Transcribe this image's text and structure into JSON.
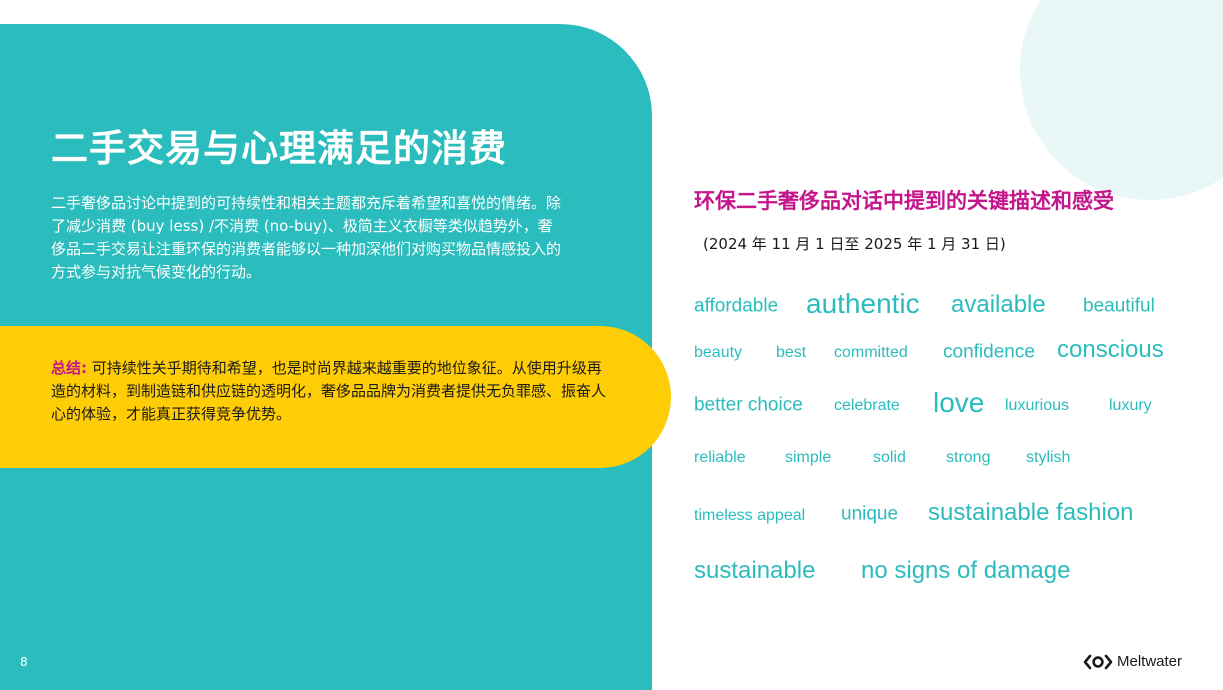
{
  "slide": {
    "title": "二手交易与心理满足的消费",
    "intro": "二手奢侈品讨论中提到的可持续性和相关主题都充斥着希望和喜悦的情绪。除了减少消费 (buy less) /不消费 (no-buy)、极简主义衣橱等类似趋势外，奢侈品二手交易让注重环保的消费者能够以一种加深他们对购买物品情感投入的方式参与对抗气候变化的行动。",
    "summary_label": "总结:",
    "summary_text": " 可持续性关乎期待和希望，也是时尚界越来越重要的地位象征。从使用升级再造的材料，到制造链和供应链的透明化，奢侈品品牌为消费者提供无负罪感、振奋人心的体验，才能真正获得竞争优势。",
    "page_number": "8"
  },
  "word_cloud": {
    "title": "环保二手奢侈品对话中提到的关键描述和感受",
    "date_range": "(2024 年 11 月 1 日至 2025 年 1 月 31 日)",
    "words": [
      {
        "text": "affordable",
        "size": "m"
      },
      {
        "text": "authentic",
        "size": "xl"
      },
      {
        "text": "available",
        "size": "l"
      },
      {
        "text": "beautiful",
        "size": "m"
      },
      {
        "text": "beauty",
        "size": "s"
      },
      {
        "text": "best",
        "size": "s"
      },
      {
        "text": "committed",
        "size": "s"
      },
      {
        "text": "confidence",
        "size": "m"
      },
      {
        "text": "conscious",
        "size": "l"
      },
      {
        "text": "better choice",
        "size": "m"
      },
      {
        "text": "celebrate",
        "size": "s"
      },
      {
        "text": "love",
        "size": "xl"
      },
      {
        "text": "luxurious",
        "size": "s"
      },
      {
        "text": "luxury",
        "size": "s"
      },
      {
        "text": "reliable",
        "size": "s"
      },
      {
        "text": "simple",
        "size": "s"
      },
      {
        "text": "solid",
        "size": "s"
      },
      {
        "text": "strong",
        "size": "s"
      },
      {
        "text": "stylish",
        "size": "s"
      },
      {
        "text": "timeless appeal",
        "size": "s"
      },
      {
        "text": "unique",
        "size": "m"
      },
      {
        "text": "sustainable fashion",
        "size": "l"
      },
      {
        "text": "sustainable",
        "size": "l"
      },
      {
        "text": "no signs of damage",
        "size": "l"
      }
    ]
  },
  "brand": {
    "name": "Meltwater",
    "icon": "meltwater-logo-icon"
  },
  "colors": {
    "teal": "#2bbcbd",
    "yellow": "#ffcd05",
    "magenta": "#c4158b"
  }
}
